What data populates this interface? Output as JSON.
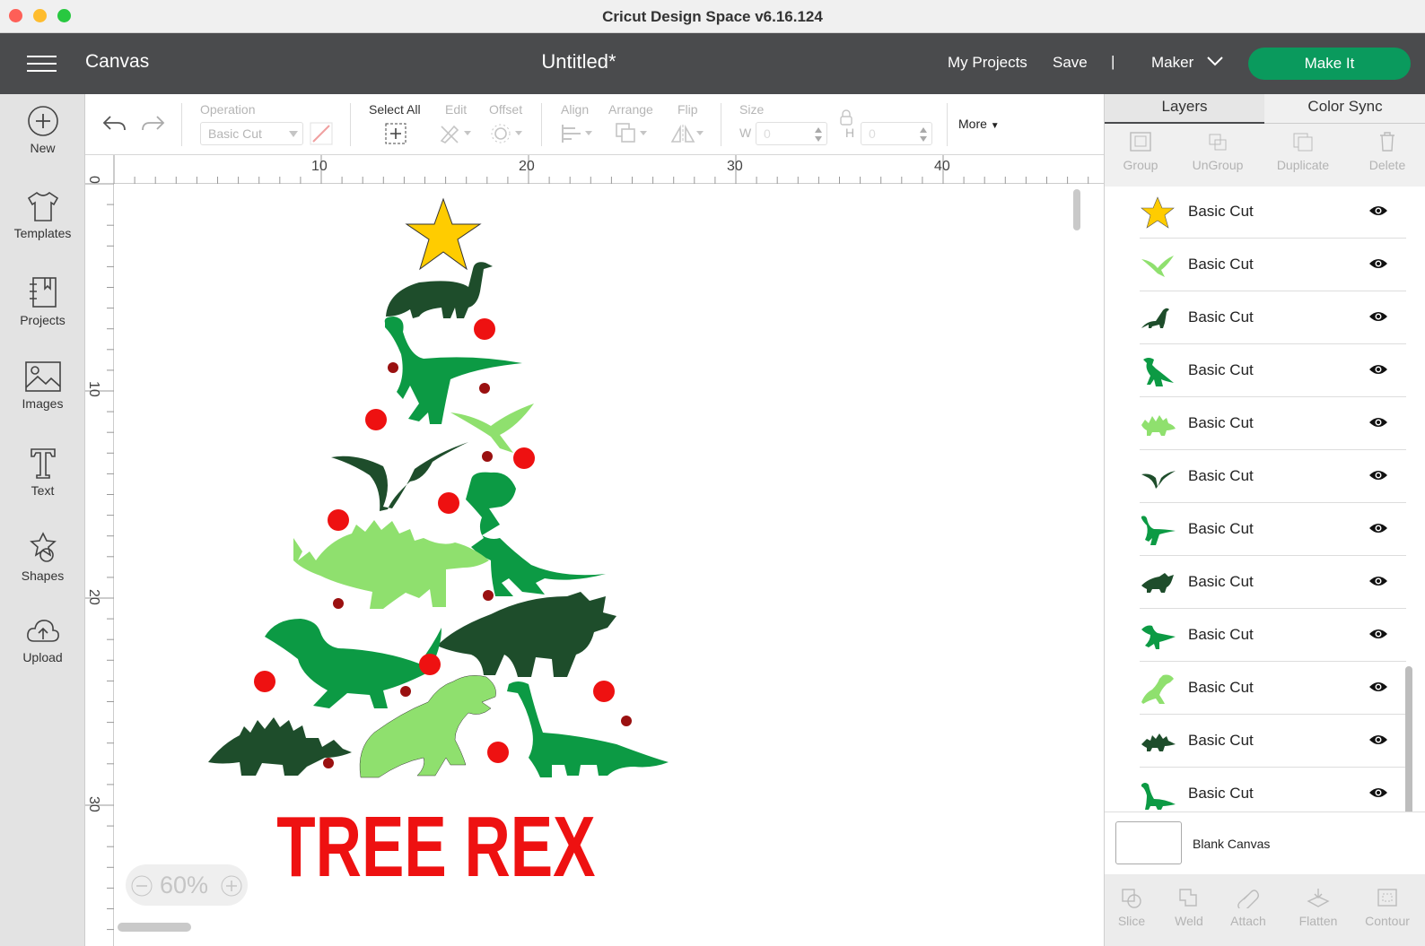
{
  "window": {
    "title": "Cricut Design Space  v6.16.124",
    "traffic_lights": [
      "#fe5f57",
      "#febc2e",
      "#28c840"
    ]
  },
  "appbar": {
    "section": "Canvas",
    "document_title": "Untitled*",
    "my_projects": "My Projects",
    "save": "Save",
    "separator": "|",
    "machine": "Maker",
    "make_it": "Make It",
    "make_it_color": "#0a9a5d"
  },
  "sidebar": [
    {
      "label": "New",
      "icon": "plus-circle-icon"
    },
    {
      "label": "Templates",
      "icon": "tshirt-icon"
    },
    {
      "label": "Projects",
      "icon": "notebook-icon"
    },
    {
      "label": "Images",
      "icon": "image-icon"
    },
    {
      "label": "Text",
      "icon": "text-t-icon"
    },
    {
      "label": "Shapes",
      "icon": "shapes-icon"
    },
    {
      "label": "Upload",
      "icon": "cloud-upload-icon"
    }
  ],
  "toolbar": {
    "operation_label": "Operation",
    "operation_value": "Basic Cut",
    "select_all": "Select All",
    "edit": "Edit",
    "offset": "Offset",
    "align": "Align",
    "arrange": "Arrange",
    "flip": "Flip",
    "size": "Size",
    "w_label": "W",
    "w_value": "0",
    "h_label": "H",
    "h_value": "0",
    "more": "More"
  },
  "ruler": {
    "top": [
      "10",
      "20",
      "30",
      "40"
    ],
    "left": [
      "0",
      "10",
      "20",
      "30"
    ]
  },
  "canvas": {
    "design_text": "TREE REX",
    "zoom": "60%",
    "colors": {
      "star": "#ffcc00",
      "dark_green": "#1e4d2b",
      "green": "#0c9a44",
      "light_green": "#8fe06e",
      "red": "#ee1111",
      "dark_red": "#9a1010"
    }
  },
  "panel": {
    "tabs": {
      "layers": "Layers",
      "color_sync": "Color Sync"
    },
    "actions": {
      "group": "Group",
      "ungroup": "UnGroup",
      "duplicate": "Duplicate",
      "delete": "Delete"
    },
    "layers": [
      {
        "name": "Basic Cut",
        "thumb": "star",
        "color": "#ffcc00"
      },
      {
        "name": "Basic Cut",
        "thumb": "pterodactyl",
        "color": "#8fe06e"
      },
      {
        "name": "Basic Cut",
        "thumb": "brachiosaurus",
        "color": "#1e4d2b"
      },
      {
        "name": "Basic Cut",
        "thumb": "trex",
        "color": "#0c9a44"
      },
      {
        "name": "Basic Cut",
        "thumb": "stegosaurus",
        "color": "#8fe06e"
      },
      {
        "name": "Basic Cut",
        "thumb": "pterodactyl",
        "color": "#1e4d2b"
      },
      {
        "name": "Basic Cut",
        "thumb": "raptor",
        "color": "#0c9a44"
      },
      {
        "name": "Basic Cut",
        "thumb": "triceratops",
        "color": "#1e4d2b"
      },
      {
        "name": "Basic Cut",
        "thumb": "parasaurolophus",
        "color": "#0c9a44"
      },
      {
        "name": "Basic Cut",
        "thumb": "trex",
        "color": "#8fe06e"
      },
      {
        "name": "Basic Cut",
        "thumb": "stegosaurus",
        "color": "#1e4d2b"
      },
      {
        "name": "Basic Cut",
        "thumb": "brachiosaurus",
        "color": "#0c9a44"
      }
    ],
    "blank_canvas": "Blank Canvas",
    "bottom_actions": {
      "slice": "Slice",
      "weld": "Weld",
      "attach": "Attach",
      "flatten": "Flatten",
      "contour": "Contour"
    }
  }
}
